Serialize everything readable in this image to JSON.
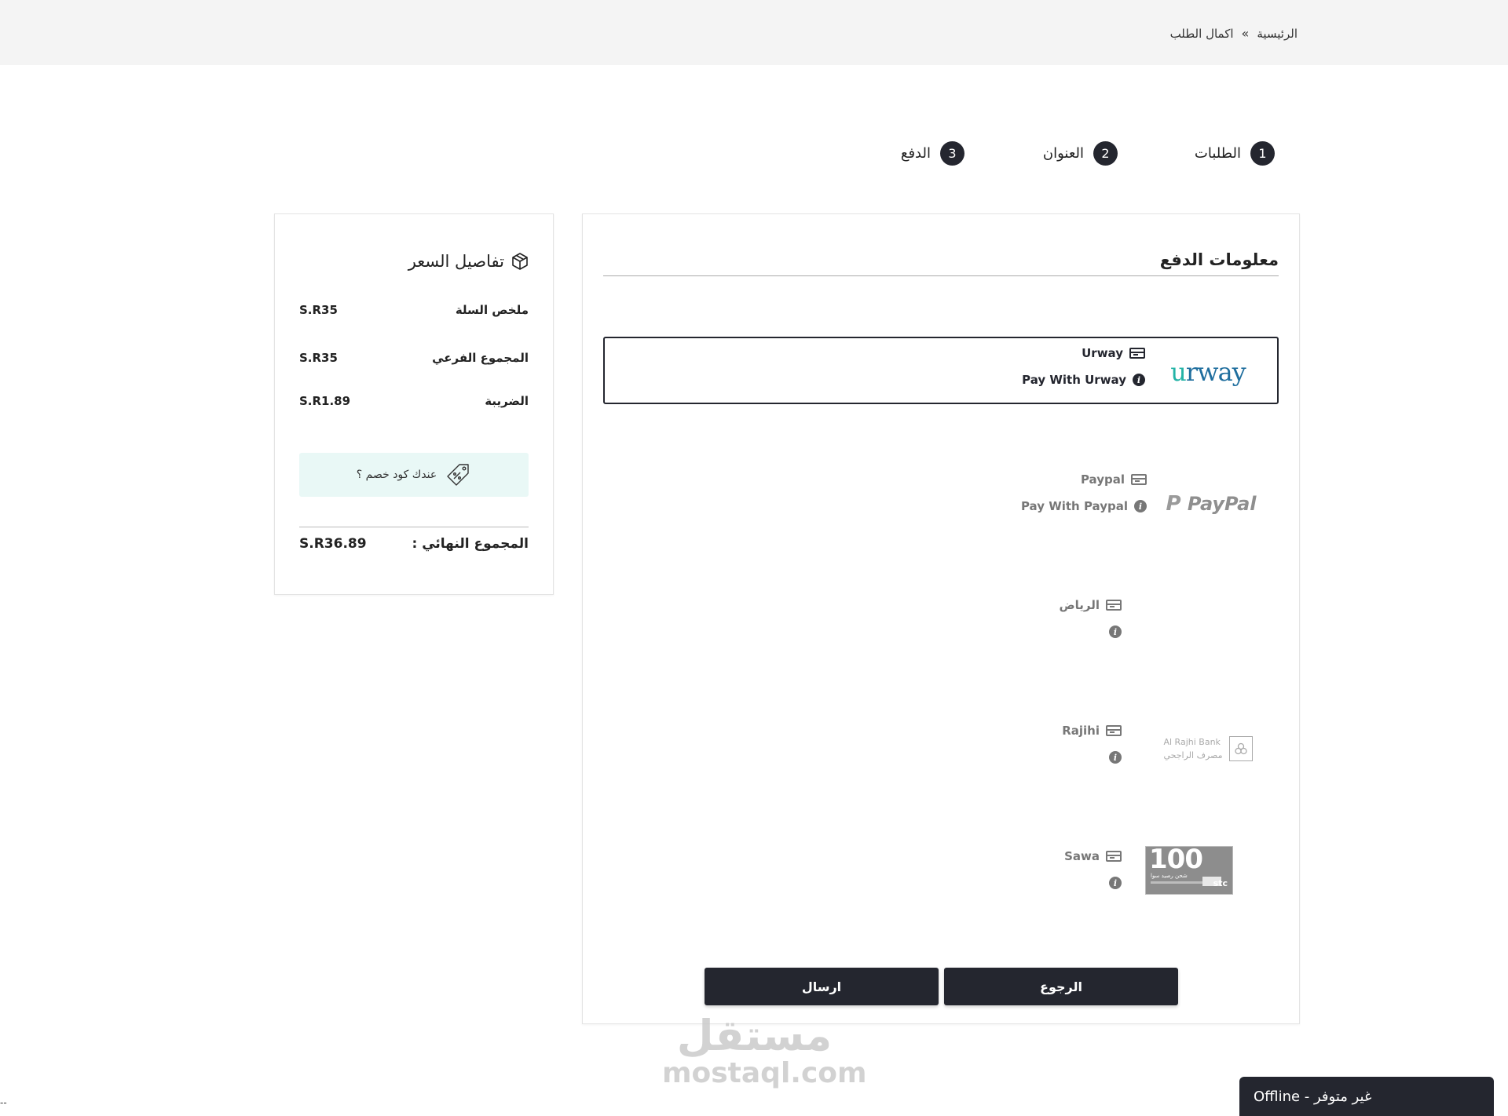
{
  "breadcrumb": {
    "home": "الرئيسية",
    "separator": "»",
    "current": "اكمال الطلب"
  },
  "steps": [
    {
      "num": "1",
      "label": "الطلبات"
    },
    {
      "num": "2",
      "label": "العنوان"
    },
    {
      "num": "3",
      "label": "الدفع"
    }
  ],
  "price": {
    "title": "تفاصيل السعر",
    "rows": [
      {
        "label": "ملخص السلة",
        "value": "S.R35"
      },
      {
        "label": "المجموع الفرعي",
        "value": "S.R35"
      },
      {
        "label": "الضريبة",
        "value": "S.R1.89"
      }
    ],
    "coupon": "عندك كود خصم ؟",
    "total_label": "المجموع النهائي :",
    "total_value": "S.R36.89"
  },
  "payment": {
    "title": "معلومات الدفع",
    "methods": [
      {
        "name": "Urway",
        "desc": "Pay With Urway",
        "logo": "urway",
        "selected": true
      },
      {
        "name": "Paypal",
        "desc": "Pay With Paypal",
        "logo": "PayPal",
        "selected": false
      },
      {
        "name": "الرياض",
        "desc": "",
        "logo": "",
        "selected": false
      },
      {
        "name": "Rajihi",
        "desc": "",
        "logo_en": "Al Rajhi Bank",
        "logo_ar": "مصرف الراجحي",
        "selected": false
      },
      {
        "name": "Sawa",
        "desc": "",
        "logo_num": "100",
        "logo_brand": "stc",
        "logo_sub": "شحن رصيد سوا",
        "selected": false
      }
    ]
  },
  "buttons": {
    "back": "الرجوع",
    "submit": "ارسال"
  },
  "watermark": {
    "ar": "مستقل",
    "en": "mostaql.com"
  },
  "chat": {
    "status": "Offline - غير متوفر"
  },
  "corner": "--"
}
